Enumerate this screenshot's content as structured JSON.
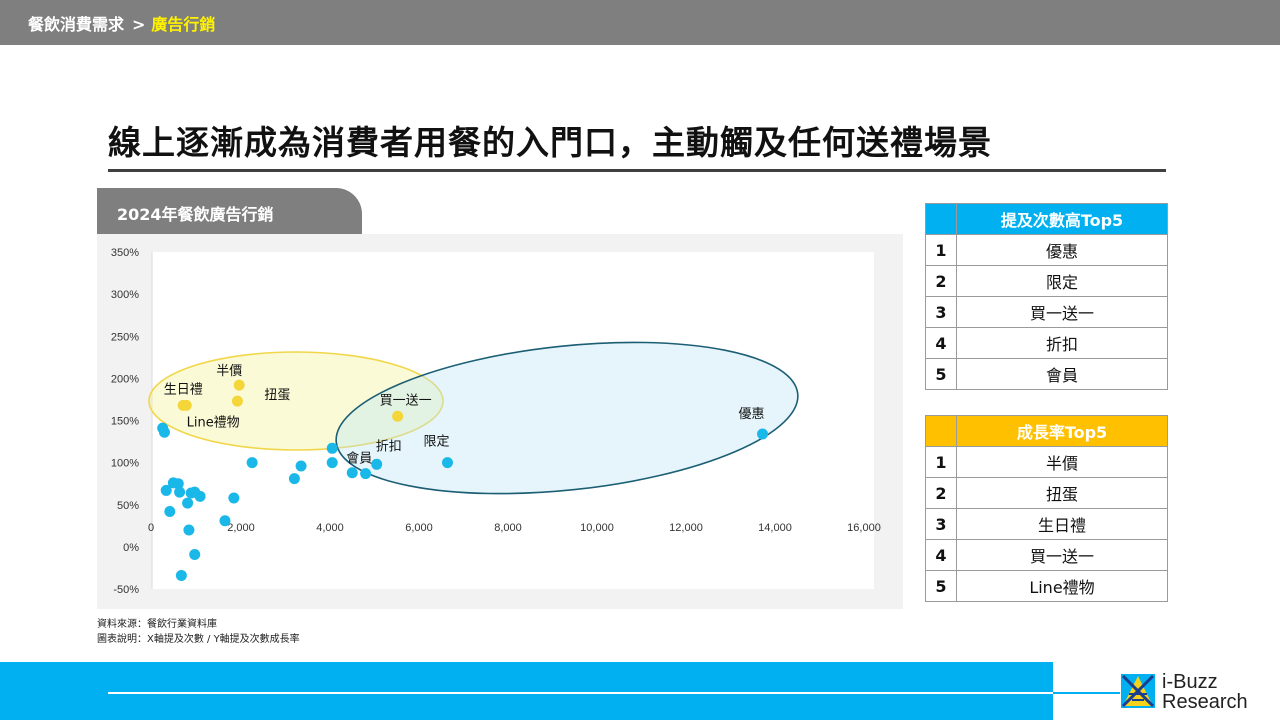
{
  "breadcrumb": {
    "parent": "餐飲消費需求",
    "separator": ">",
    "current": "廣告行銷"
  },
  "page_title": "線上逐漸成為消費者用餐的入門口，主動觸及任何送禮場景",
  "chart_tab": "2024年餐飲廣告行銷",
  "chart_data": {
    "type": "scatter",
    "title": "",
    "xlabel": "",
    "ylabel": "",
    "xlim": [
      0,
      16000
    ],
    "ylim": [
      -50,
      350
    ],
    "x_ticks": [
      "0",
      "2,000",
      "4,000",
      "6,000",
      "8,000",
      "10,000",
      "12,000",
      "14,000",
      "16,000"
    ],
    "y_ticks": [
      "350%",
      "300%",
      "250%",
      "200%",
      "150%",
      "100%",
      "50%",
      "0%",
      "-50%"
    ],
    "grid": false,
    "colors": {
      "points": "#1ab8e8",
      "highlight": "#f5d63a"
    },
    "points": [
      {
        "x": 13720,
        "y": 134,
        "label": "優惠",
        "group": "top"
      },
      {
        "x": 6640,
        "y": 100,
        "label": "限定",
        "group": "top"
      },
      {
        "x": 5520,
        "y": 155,
        "label": "買一送一",
        "group": "both"
      },
      {
        "x": 5050,
        "y": 98,
        "label": "折扣",
        "group": "top"
      },
      {
        "x": 4500,
        "y": 88,
        "label": "會員",
        "group": "top"
      },
      {
        "x": 1960,
        "y": 192,
        "label": "半價",
        "group": "growth"
      },
      {
        "x": 1920,
        "y": 173,
        "label": "扭蛋",
        "group": "growth"
      },
      {
        "x": 770,
        "y": 168,
        "label": "生日禮",
        "group": "growth"
      },
      {
        "x": 700,
        "y": 168,
        "label": "Line禮物",
        "group": "growth"
      },
      {
        "x": 4050,
        "y": 117,
        "group": "other"
      },
      {
        "x": 4050,
        "y": 100,
        "group": "other"
      },
      {
        "x": 4800,
        "y": 87,
        "group": "other"
      },
      {
        "x": 3350,
        "y": 96,
        "group": "other"
      },
      {
        "x": 3200,
        "y": 81,
        "group": "other"
      },
      {
        "x": 2250,
        "y": 100,
        "group": "other"
      },
      {
        "x": 1840,
        "y": 58,
        "group": "other"
      },
      {
        "x": 1640,
        "y": 31,
        "group": "other"
      },
      {
        "x": 240,
        "y": 141,
        "group": "other"
      },
      {
        "x": 280,
        "y": 136,
        "group": "other"
      },
      {
        "x": 320,
        "y": 67,
        "group": "other"
      },
      {
        "x": 400,
        "y": 42,
        "group": "other"
      },
      {
        "x": 480,
        "y": 76,
        "group": "other"
      },
      {
        "x": 590,
        "y": 75,
        "group": "other"
      },
      {
        "x": 620,
        "y": 65,
        "group": "other"
      },
      {
        "x": 800,
        "y": 52,
        "group": "other"
      },
      {
        "x": 880,
        "y": 64,
        "group": "other"
      },
      {
        "x": 960,
        "y": 65,
        "group": "other"
      },
      {
        "x": 1080,
        "y": 60,
        "group": "other"
      },
      {
        "x": 830,
        "y": 20,
        "group": "other"
      },
      {
        "x": 960,
        "y": -9,
        "group": "other"
      },
      {
        "x": 660,
        "y": -34,
        "group": "other"
      }
    ]
  },
  "source_note": "資料來源：餐飲行業資料庫",
  "chart_note": "圖表說明：X軸提及次數 / Y軸提及次數成長率",
  "top_mentions": {
    "header": "提及次數高Top5",
    "rows": [
      {
        "rank": "1",
        "name": "優惠"
      },
      {
        "rank": "2",
        "name": "限定"
      },
      {
        "rank": "3",
        "name": "買一送一"
      },
      {
        "rank": "4",
        "name": "折扣"
      },
      {
        "rank": "5",
        "name": "會員"
      }
    ]
  },
  "top_growth": {
    "header": "成長率Top5",
    "rows": [
      {
        "rank": "1",
        "name": "半價"
      },
      {
        "rank": "2",
        "name": "扭蛋"
      },
      {
        "rank": "3",
        "name": "生日禮"
      },
      {
        "rank": "4",
        "name": "買一送一"
      },
      {
        "rank": "5",
        "name": "Line禮物"
      }
    ]
  },
  "logo": {
    "line1": "i-Buzz",
    "line2": "Research"
  }
}
